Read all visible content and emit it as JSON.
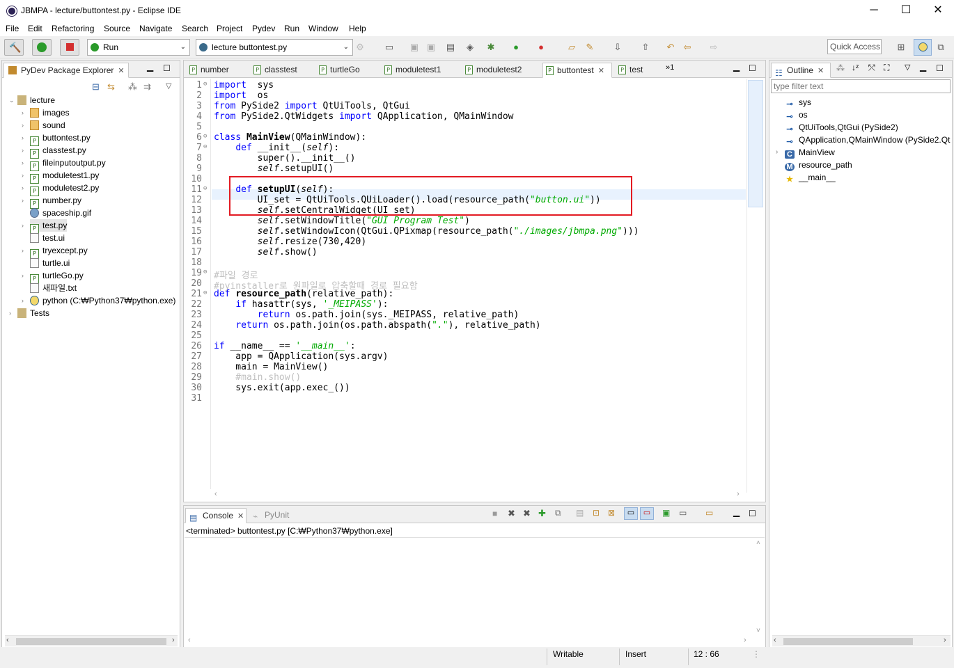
{
  "window": {
    "title": "JBMPA - lecture/buttontest.py - Eclipse IDE",
    "minimize": "─",
    "maximize": "☐",
    "close": "✕"
  },
  "menu": [
    "File",
    "Edit",
    "Refactoring",
    "Source",
    "Navigate",
    "Search",
    "Project",
    "Pydev",
    "Run",
    "Window",
    "Help"
  ],
  "toolbar": {
    "run_config": "Run",
    "launch_target": "lecture buttontest.py",
    "quick_access": "Quick Access"
  },
  "explorer": {
    "title": "PyDev Package Explorer",
    "items": [
      {
        "label": "lecture",
        "icon": "project-icon",
        "twisty": "⌄"
      },
      {
        "label": "images",
        "icon": "package-icon",
        "twisty": "›"
      },
      {
        "label": "sound",
        "icon": "package-icon",
        "twisty": "›"
      },
      {
        "label": "buttontest.py",
        "icon": "python-file-icon",
        "twisty": "›"
      },
      {
        "label": "classtest.py",
        "icon": "python-file-icon",
        "twisty": "›"
      },
      {
        "label": "fileinputoutput.py",
        "icon": "python-file-icon",
        "twisty": "›"
      },
      {
        "label": "moduletest1.py",
        "icon": "python-file-icon",
        "twisty": "›"
      },
      {
        "label": "moduletest2.py",
        "icon": "python-file-icon",
        "twisty": "›"
      },
      {
        "label": "number.py",
        "icon": "python-file-icon",
        "twisty": "›"
      },
      {
        "label": "spaceship.gif",
        "icon": "image-file-icon",
        "twisty": ""
      },
      {
        "label": "test.py",
        "icon": "python-file-icon",
        "twisty": "›"
      },
      {
        "label": "test.ui",
        "icon": "text-file-icon",
        "twisty": ""
      },
      {
        "label": "tryexcept.py",
        "icon": "python-file-icon",
        "twisty": "›"
      },
      {
        "label": "turtle.ui",
        "icon": "text-file-icon",
        "twisty": ""
      },
      {
        "label": "turtleGo.py",
        "icon": "python-file-icon",
        "twisty": "›"
      },
      {
        "label": "새파일.txt",
        "icon": "text-file-icon",
        "twisty": ""
      },
      {
        "label": "python  (C:₩Python37₩python.exe)",
        "icon": "python-interpreter-icon",
        "twisty": "›"
      },
      {
        "label": "Tests",
        "icon": "project-icon",
        "twisty": "›"
      }
    ]
  },
  "editor_tabs": [
    {
      "label": "number"
    },
    {
      "label": "classtest"
    },
    {
      "label": "turtleGo"
    },
    {
      "label": "moduletest1"
    },
    {
      "label": "moduletest2"
    },
    {
      "label": "buttontest",
      "active": true
    },
    {
      "label": "test"
    }
  ],
  "editor_overflow": "»1",
  "code_lines": [
    {
      "n": "1",
      "fold": "⊖",
      "parts": [
        [
          "kw",
          "import"
        ],
        [
          "",
          "  sys"
        ]
      ]
    },
    {
      "n": "2",
      "fold": "",
      "parts": [
        [
          "kw",
          "import"
        ],
        [
          "",
          "  os"
        ]
      ]
    },
    {
      "n": "3",
      "fold": "",
      "parts": [
        [
          "kw",
          "from"
        ],
        [
          "",
          " PySide2 "
        ],
        [
          "kw",
          "import"
        ],
        [
          "",
          " QtUiTools, QtGui"
        ]
      ]
    },
    {
      "n": "4",
      "fold": "",
      "parts": [
        [
          "kw",
          "from"
        ],
        [
          "",
          " PySide2.QtWidgets "
        ],
        [
          "kw",
          "import"
        ],
        [
          "",
          " QApplication, QMainWindow"
        ]
      ]
    },
    {
      "n": "5",
      "fold": "",
      "parts": []
    },
    {
      "n": "6",
      "fold": "⊖",
      "parts": [
        [
          "kw",
          "class"
        ],
        [
          "",
          " "
        ],
        [
          "bold",
          "MainView"
        ],
        [
          "",
          "(QMainWindow):"
        ]
      ]
    },
    {
      "n": "7",
      "fold": "⊖",
      "parts": [
        [
          "",
          "    "
        ],
        [
          "kw",
          "def"
        ],
        [
          "",
          " __init__("
        ],
        [
          "selfkw",
          "self"
        ],
        [
          "",
          "):"
        ]
      ]
    },
    {
      "n": "8",
      "fold": "",
      "parts": [
        [
          "",
          "        super().__init__()"
        ]
      ]
    },
    {
      "n": "9",
      "fold": "",
      "parts": [
        [
          "",
          "        "
        ],
        [
          "selfkw",
          "self"
        ],
        [
          "",
          ".setupUI()"
        ]
      ]
    },
    {
      "n": "10",
      "fold": "",
      "parts": []
    },
    {
      "n": "11",
      "fold": "⊖",
      "parts": [
        [
          "",
          "    "
        ],
        [
          "kw",
          "def"
        ],
        [
          "",
          " "
        ],
        [
          "bold",
          "setupUI"
        ],
        [
          "",
          "("
        ],
        [
          "selfkw",
          "self"
        ],
        [
          "",
          "):"
        ]
      ]
    },
    {
      "n": "12",
      "fold": "",
      "parts": [
        [
          "",
          "        UI_set = QtUiTools.QUiLoader().load(resource_path("
        ],
        [
          "str",
          "\"button.ui\""
        ],
        [
          "",
          "))"
        ]
      ]
    },
    {
      "n": "13",
      "fold": "",
      "parts": [
        [
          "",
          "        "
        ],
        [
          "selfkw",
          "self"
        ],
        [
          "",
          ".setCentralWidget(UI_set)"
        ]
      ]
    },
    {
      "n": "14",
      "fold": "",
      "parts": [
        [
          "",
          "        "
        ],
        [
          "selfkw",
          "self"
        ],
        [
          "",
          ".setWindowTitle("
        ],
        [
          "str",
          "\"GUI Program Test\""
        ],
        [
          "",
          ")"
        ]
      ]
    },
    {
      "n": "15",
      "fold": "",
      "parts": [
        [
          "",
          "        "
        ],
        [
          "selfkw",
          "self"
        ],
        [
          "",
          ".setWindowIcon(QtGui.QPixmap(resource_path("
        ],
        [
          "str",
          "\"./images/jbmpa.png\""
        ],
        [
          "",
          ")))"
        ]
      ]
    },
    {
      "n": "16",
      "fold": "",
      "parts": [
        [
          "",
          "        "
        ],
        [
          "selfkw",
          "self"
        ],
        [
          "",
          ".resize(730,420)"
        ]
      ]
    },
    {
      "n": "17",
      "fold": "",
      "parts": [
        [
          "",
          "        "
        ],
        [
          "selfkw",
          "self"
        ],
        [
          "",
          ".show()"
        ]
      ]
    },
    {
      "n": "18",
      "fold": "",
      "parts": []
    },
    {
      "n": "19",
      "fold": "⊖",
      "parts": [
        [
          "cmt",
          "#파일 경로"
        ]
      ]
    },
    {
      "n": "20",
      "fold": "",
      "parts": [
        [
          "cmt",
          "#pyinstaller로 원파일로 압축할때 경로 필요함"
        ]
      ]
    },
    {
      "n": "21",
      "fold": "⊖",
      "parts": [
        [
          "kw",
          "def"
        ],
        [
          "",
          " "
        ],
        [
          "bold",
          "resource_path"
        ],
        [
          "",
          "(relative_path):"
        ]
      ]
    },
    {
      "n": "22",
      "fold": "",
      "parts": [
        [
          "",
          "    "
        ],
        [
          "kw",
          "if"
        ],
        [
          "",
          " hasattr(sys, "
        ],
        [
          "str",
          "'_MEIPASS'"
        ],
        [
          "",
          "):"
        ]
      ]
    },
    {
      "n": "23",
      "fold": "",
      "parts": [
        [
          "",
          "        "
        ],
        [
          "kw",
          "return"
        ],
        [
          "",
          " os.path.join(sys._MEIPASS, relative_path)"
        ]
      ]
    },
    {
      "n": "24",
      "fold": "",
      "parts": [
        [
          "",
          "    "
        ],
        [
          "kw",
          "return"
        ],
        [
          "",
          " os.path.join(os.path.abspath("
        ],
        [
          "str",
          "\".\""
        ],
        [
          "",
          "), relative_path)"
        ]
      ]
    },
    {
      "n": "25",
      "fold": "",
      "parts": []
    },
    {
      "n": "26",
      "fold": "",
      "parts": [
        [
          "kw",
          "if"
        ],
        [
          "",
          " __name__ == "
        ],
        [
          "str",
          "'__main__'"
        ],
        [
          "",
          ":"
        ]
      ]
    },
    {
      "n": "27",
      "fold": "",
      "parts": [
        [
          "",
          "    app = QApplication(sys.argv)"
        ]
      ]
    },
    {
      "n": "28",
      "fold": "",
      "parts": [
        [
          "",
          "    main = MainView()"
        ]
      ]
    },
    {
      "n": "29",
      "fold": "",
      "parts": [
        [
          "cmt",
          "    #main.show()"
        ]
      ]
    },
    {
      "n": "30",
      "fold": "",
      "parts": [
        [
          "",
          "    sys.exit(app.exec_())"
        ]
      ]
    },
    {
      "n": "31",
      "fold": "",
      "parts": []
    }
  ],
  "outline": {
    "title": "Outline",
    "filter_placeholder": "type filter text",
    "items": [
      {
        "label": "sys",
        "icon": "import-icon",
        "twisty": ""
      },
      {
        "label": "os",
        "icon": "import-icon",
        "twisty": ""
      },
      {
        "label": "QtUiTools,QtGui (PySide2)",
        "icon": "import-icon",
        "twisty": ""
      },
      {
        "label": "QApplication,QMainWindow (PySide2.Qt",
        "icon": "import-icon",
        "twisty": ""
      },
      {
        "label": "MainView",
        "icon": "class-icon",
        "twisty": "›"
      },
      {
        "label": "resource_path",
        "icon": "method-icon",
        "twisty": ""
      },
      {
        "label": "__main__",
        "icon": "star-icon",
        "twisty": ""
      }
    ]
  },
  "console": {
    "tab_console": "Console",
    "tab_pyunit": "PyUnit",
    "status": "<terminated> buttontest.py [C:₩Python37₩python.exe]"
  },
  "statusbar": {
    "writable": "Writable",
    "insert": "Insert",
    "position": "12 : 66"
  },
  "colors": {
    "highlight_box": "#e31b23",
    "keyword": "#0000ff",
    "string": "#00aa00",
    "comment": "#c0c0c0"
  }
}
